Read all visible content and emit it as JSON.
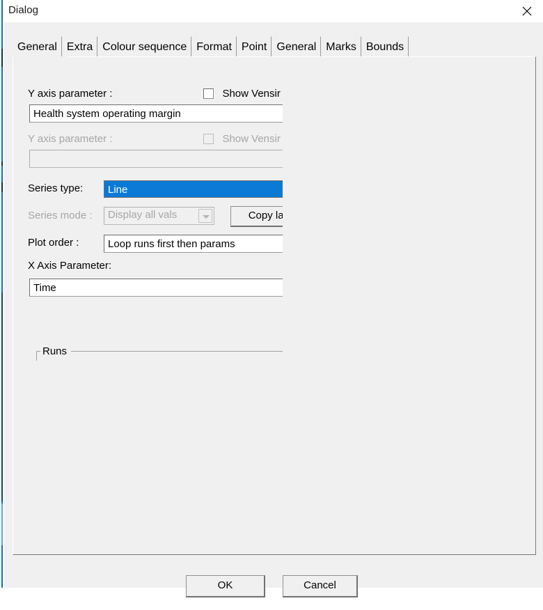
{
  "window": {
    "title": "Dialog",
    "close_icon": "close-icon"
  },
  "tabs": [
    {
      "label": "General",
      "selected": true
    },
    {
      "label": "Extra",
      "selected": false
    },
    {
      "label": "Colour sequence",
      "selected": false
    },
    {
      "label": "Format",
      "selected": false
    },
    {
      "label": "Point",
      "selected": false
    },
    {
      "label": "General",
      "selected": false
    },
    {
      "label": "Marks",
      "selected": false
    },
    {
      "label": "Bounds",
      "selected": false
    }
  ],
  "general_tab": {
    "y_axis_primary": {
      "label": "Y axis parameter :",
      "value": "Health system operating margin",
      "checkbox_label": "Show Vensir",
      "checked": false,
      "enabled": true
    },
    "y_axis_secondary": {
      "label": "Y axis parameter :",
      "value": "",
      "checkbox_label": "Show Vensir",
      "checked": false,
      "enabled": false
    },
    "series_type": {
      "label": "Series type:",
      "value": "Line"
    },
    "series_mode": {
      "label": "Series mode :",
      "value": "Display all vals",
      "enabled": false,
      "arrow_icon": "chevron-down-icon"
    },
    "copy_label_button": "Copy labe",
    "plot_order": {
      "label": "Plot order :",
      "value": "Loop runs first then params"
    },
    "x_axis": {
      "label": "X Axis Parameter:",
      "value": "Time"
    },
    "runs_group": {
      "title": "Runs"
    }
  },
  "footer": {
    "ok_label": "OK",
    "cancel_label": "Cancel"
  },
  "colors": {
    "accent_selection": "#0b7ad6",
    "window_bg": "#f0f0f0",
    "field_bg": "#ffffff",
    "disabled_text": "#a6a6a6",
    "border": "#9a9a9a",
    "bg_app_accent": "#0d6cc4"
  }
}
